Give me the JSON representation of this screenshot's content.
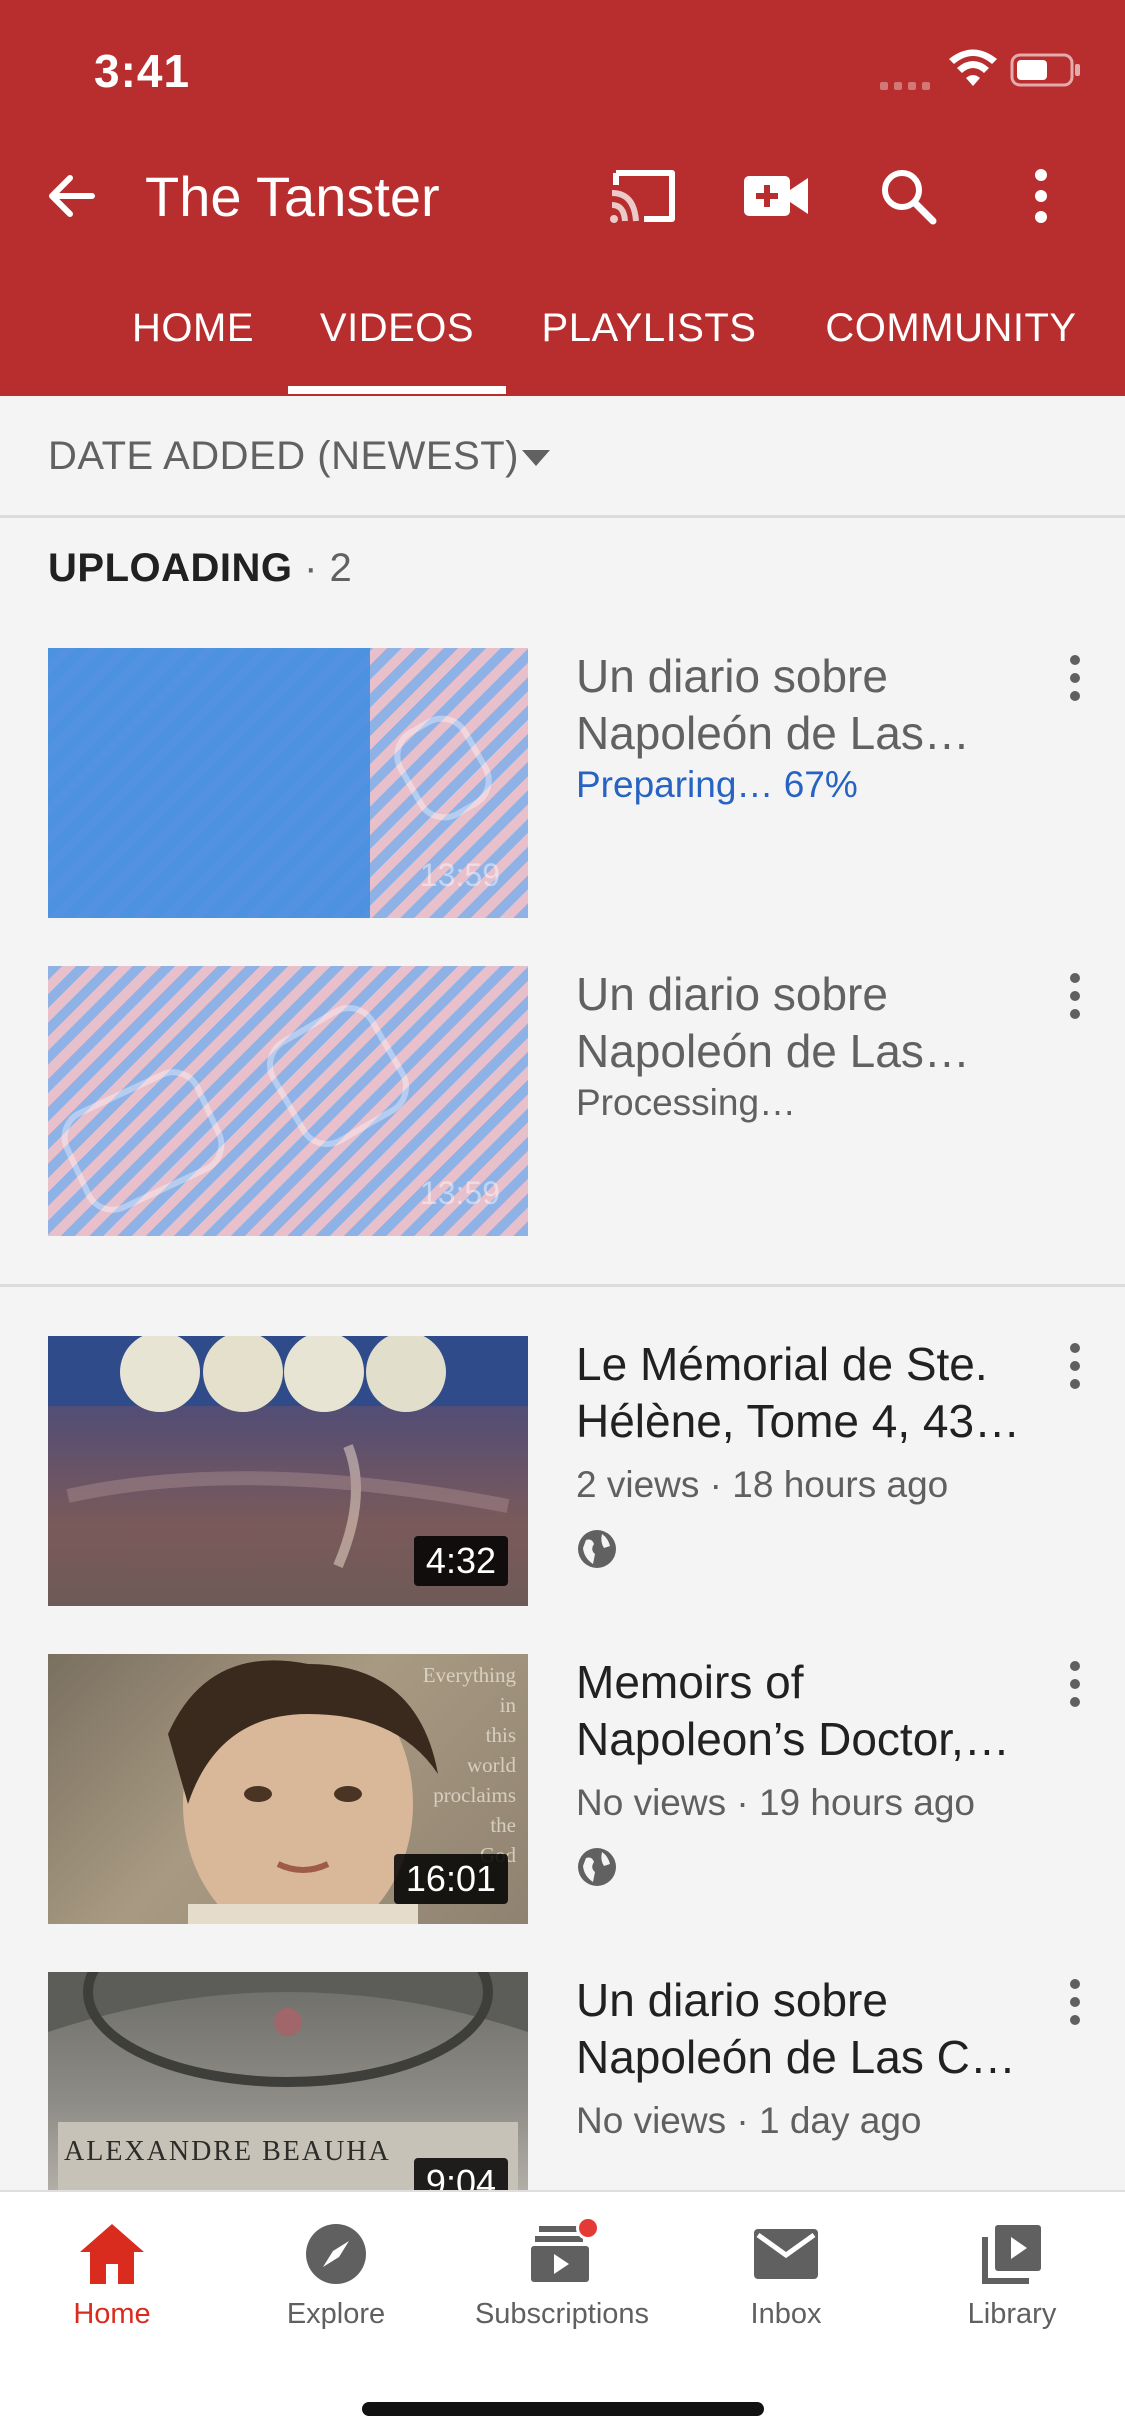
{
  "status_bar": {
    "time": "3:41"
  },
  "header": {
    "title": "The Tanster",
    "icons": [
      "back-arrow-icon",
      "cast-icon",
      "video-camera-plus-icon",
      "search-icon",
      "more-vert-icon"
    ]
  },
  "tabs": [
    {
      "label": "HOME"
    },
    {
      "label": "VIDEOS",
      "selected": true
    },
    {
      "label": "PLAYLISTS"
    },
    {
      "label": "COMMUNITY"
    }
  ],
  "sort": {
    "label": "DATE ADDED (NEWEST)"
  },
  "uploading": {
    "heading": "UPLOADING",
    "count_text": "· 2",
    "items": [
      {
        "title_line1": "Un diario sobre",
        "title_line2": "Napoleón de Las…",
        "status": "Preparing… 67%",
        "progress": 0.67,
        "duration": "13:59"
      },
      {
        "title_line1": "Un diario sobre",
        "title_line2": "Napoleón de Las…",
        "status": "Processing…",
        "duration": "13:59"
      }
    ]
  },
  "videos": [
    {
      "title_line1": "Le Mémorial de Ste.",
      "title_line2": "Hélène, Tome 4, 43…",
      "meta": "2 views · 18 hours ago",
      "duration": "4:32"
    },
    {
      "title_line1": "Memoirs of",
      "title_line2": "Napoleon’s Doctor,…",
      "meta": "No views · 19 hours ago",
      "duration": "16:01",
      "thumb_text": [
        "Everything",
        "in",
        "this",
        "world",
        "proclaims",
        "the",
        "God"
      ]
    },
    {
      "title_line1": "Un diario sobre",
      "title_line2": "Napoleón de Las C…",
      "meta": "No views · 1 day ago",
      "duration": "9:04",
      "thumb_text": "ALEXANDRE BEAUHA"
    }
  ],
  "bottom_nav": [
    {
      "label": "Home",
      "icon": "home-icon",
      "active": true,
      "color": "#d92c1f"
    },
    {
      "label": "Explore",
      "icon": "compass-icon"
    },
    {
      "label": "Subscriptions",
      "icon": "subscriptions-icon",
      "badge_color": "#e53935"
    },
    {
      "label": "Inbox",
      "icon": "mail-icon"
    },
    {
      "label": "Library",
      "icon": "library-icon"
    }
  ],
  "colors": {
    "brand_red": "#b82e2e",
    "link_blue": "#2763c2",
    "active_red": "#d92c1f"
  }
}
